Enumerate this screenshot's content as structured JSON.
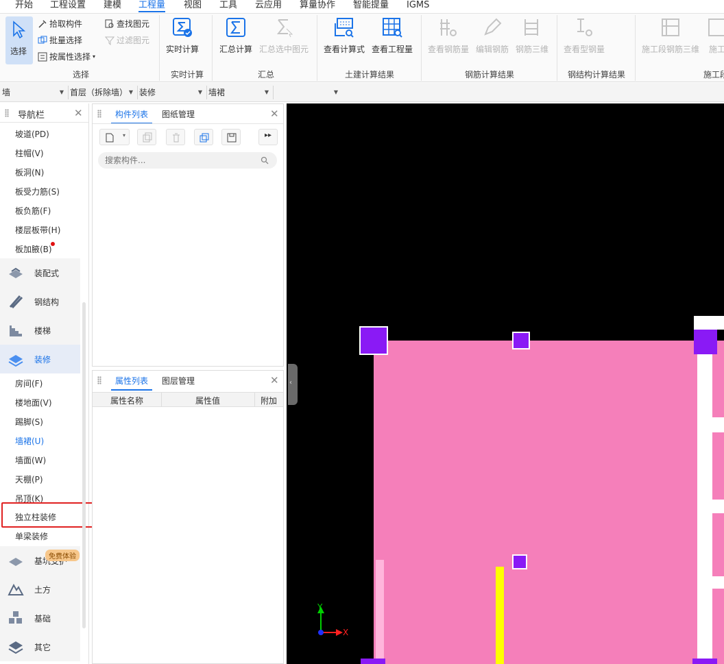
{
  "menu": [
    "开始",
    "工程设置",
    "建模",
    "工程量",
    "视图",
    "工具",
    "云应用",
    "算量协作",
    "智能提量",
    "IGMS"
  ],
  "active_menu": "工程量",
  "ribbon": {
    "select_group": {
      "label": "选择",
      "big": "选择",
      "pick": "拾取构件",
      "batch": "批量选择",
      "by_attr": "按属性选择",
      "find": "查找图元",
      "filter": "过滤图元"
    },
    "realtime_group": {
      "label": "实时计算",
      "btn": "实时计算"
    },
    "summary_group": {
      "label": "汇总",
      "btn1": "汇总计算",
      "btn2": "汇总选中图元"
    },
    "civil_group": {
      "label": "土建计算结果",
      "btn1": "查看计算式",
      "btn2": "查看工程量"
    },
    "rebar_group": {
      "label": "钢筋计算结果",
      "btn1": "查看钢筋量",
      "btn2": "编辑钢筋",
      "btn3": "钢筋三维"
    },
    "steel_group": {
      "label": "钢结构计算结果",
      "btn1": "查看型钢量"
    },
    "stage_group": {
      "label": "施工段",
      "btn1": "施工段钢筋三维",
      "btn2": "施工"
    }
  },
  "selectors": [
    "墙",
    "首层（拆除墙）",
    "装修",
    "墙裙",
    ""
  ],
  "nav": {
    "title": "导航栏",
    "items_top": [
      "坡道(PD)",
      "柱帽(V)",
      "板洞(N)",
      "板受力筋(S)",
      "板负筋(F)",
      "楼层板带(H)",
      "板加腋(B)"
    ],
    "cats_top": [
      "装配式",
      "钢结构",
      "楼梯",
      "装修"
    ],
    "items_deco": [
      "房间(F)",
      "楼地面(V)",
      "踢脚(S)",
      "墙裙(U)",
      "墙面(W)",
      "天棚(P)",
      "吊顶(K)",
      "独立柱装修",
      "单梁装修"
    ],
    "cats_bottom": [
      "基坑支护",
      "土方",
      "基础",
      "其它"
    ],
    "badge": "免费体验",
    "selected_item": "墙裙(U)"
  },
  "component_panel": {
    "tab1": "构件列表",
    "tab2": "图纸管理",
    "search_placeholder": "搜索构件..."
  },
  "property_panel": {
    "tab1": "属性列表",
    "tab2": "图层管理",
    "col1": "属性名称",
    "col2": "属性值",
    "col3": "附加"
  },
  "canvas": {
    "axis_x": "X",
    "axis_y": "Y"
  },
  "colors": {
    "accent": "#1a73e8",
    "wall_fill": "#f57fba",
    "column": "#8a1af5",
    "highlight_box": "#e02020"
  }
}
